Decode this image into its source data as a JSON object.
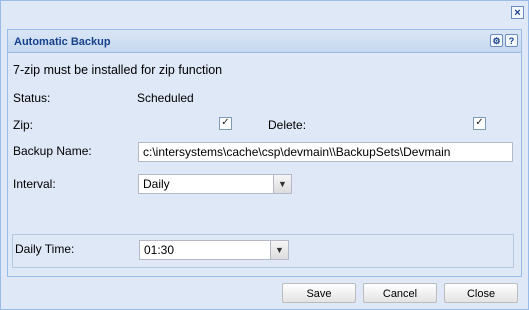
{
  "window": {
    "close_glyph": "×"
  },
  "panel": {
    "title": "Automatic Backup",
    "tools": {
      "settings_glyph": "⚙",
      "help_glyph": "?"
    }
  },
  "form": {
    "note": "7-zip must be installed for zip function",
    "status_label": "Status:",
    "status_value": "Scheduled",
    "zip_label": "Zip:",
    "zip_checked": true,
    "delete_label": "Delete:",
    "delete_checked": true,
    "backup_name_label": "Backup Name:",
    "backup_name_value": "c:\\intersystems\\cache\\csp\\devmain\\\\BackupSets\\Devmain",
    "interval_label": "Interval:",
    "interval_value": "Daily",
    "daily_time_label": "Daily Time:",
    "daily_time_value": "01:30",
    "check_glyph": "✓",
    "dropdown_glyph": "▼"
  },
  "footer": {
    "save_label": "Save",
    "cancel_label": "Cancel",
    "close_label": "Close"
  },
  "icons": [
    "close-icon",
    "gear-icon",
    "help-icon",
    "check-icon",
    "chevron-down-icon"
  ]
}
